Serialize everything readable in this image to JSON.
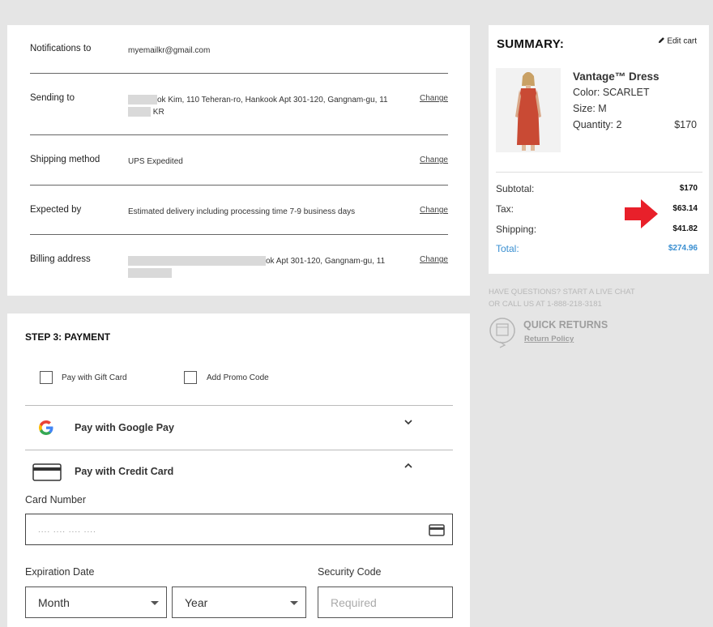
{
  "info": {
    "notifications": {
      "label": "Notifications to",
      "value": "myemailkr@gmail.com"
    },
    "sending": {
      "label": "Sending to",
      "value_line1": "ok Kim, 110 Teheran-ro, Hankook Apt 301-120, Gangnam-gu, 11",
      "value_line2": "KR",
      "change": "Change"
    },
    "shipping": {
      "label": "Shipping method",
      "value": "UPS Expedited",
      "change": "Change"
    },
    "expected": {
      "label": "Expected by",
      "value": "Estimated delivery including processing time 7-9 business days",
      "change": "Change"
    },
    "billing": {
      "label": "Billing address",
      "value": "ok Apt 301-120, Gangnam-gu, 11",
      "change": "Change"
    }
  },
  "summary": {
    "title": "SUMMARY:",
    "edit_cart": "Edit cart",
    "product": {
      "name": "Vantage™ Dress",
      "color": "Color: SCARLET",
      "size": "Size: M",
      "quantity": "Quantity: 2",
      "price": "$170"
    },
    "rows": {
      "subtotal": {
        "label": "Subtotal:",
        "value": "$170"
      },
      "tax": {
        "label": "Tax:",
        "value": "$63.14"
      },
      "shipping": {
        "label": "Shipping:",
        "value": "$41.82"
      },
      "total": {
        "label": "Total:",
        "value": "$274.96"
      }
    },
    "accent_color": "#3a8fd1",
    "arrow_color": "#e8202a"
  },
  "help": {
    "line1": "HAVE QUESTIONS? START A LIVE CHAT",
    "line2": "OR CALL US AT 1-888-218-3181",
    "quick_returns": "QUICK RETURNS",
    "return_policy": "Return Policy"
  },
  "payment": {
    "step_title": "STEP 3: PAYMENT",
    "gift_card": "Pay with Gift Card",
    "promo_code": "Add Promo Code",
    "google_pay": "Pay with Google Pay",
    "credit_card": "Pay with Credit Card",
    "card_number_label": "Card Number",
    "card_number_placeholder": ".... .... .... ....",
    "expiration_label": "Expiration Date",
    "month": "Month",
    "year": "Year",
    "security_label": "Security Code",
    "security_placeholder": "Required"
  }
}
